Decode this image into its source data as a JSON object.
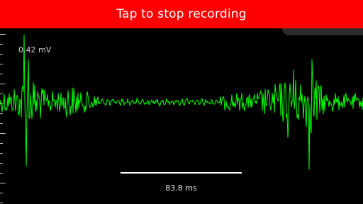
{
  "banner": {
    "label": "Tap to stop recording",
    "color": "#ff0000"
  },
  "scope": {
    "amplitude_label": "0.42 mV",
    "time_scale_label": "83.8 ms",
    "trace_color": "#00ff00",
    "background_color": "#000000"
  }
}
